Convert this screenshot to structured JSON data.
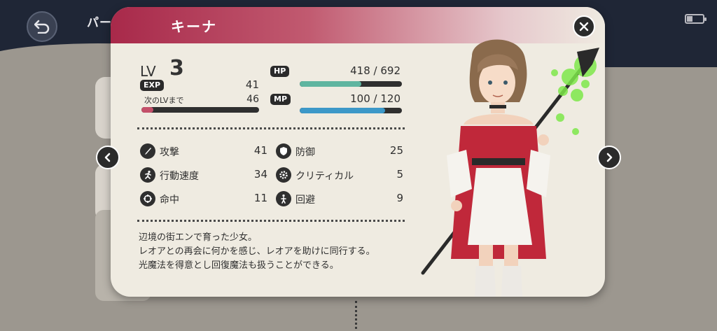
{
  "background": {
    "title": "パーテ",
    "back_icon": "back-arrow-icon",
    "battery_icon": "battery-icon"
  },
  "modal": {
    "title": "キーナ",
    "header_gradient": [
      "#a8294a",
      "#efebe1"
    ],
    "close_icon": "close-icon",
    "prev_icon": "chevron-left-icon",
    "next_icon": "chevron-right-icon"
  },
  "level": {
    "label": "LV",
    "value": "3",
    "exp_label": "EXP",
    "exp_value": "41",
    "next_label": "次のLVまで",
    "next_value": "46",
    "exp_progress": 0.1,
    "exp_color": "#c4506a"
  },
  "hp": {
    "label": "HP",
    "text": "418 / 692",
    "current": 418,
    "max": 692,
    "color": "#5fb5a0"
  },
  "mp": {
    "label": "MP",
    "text": "100 / 120",
    "current": 100,
    "max": 120,
    "color": "#3c98c8"
  },
  "stats": [
    {
      "icon": "sword-icon",
      "label": "攻撃",
      "value": "41"
    },
    {
      "icon": "shield-icon",
      "label": "防御",
      "value": "25"
    },
    {
      "icon": "running-icon",
      "label": "行動速度",
      "value": "34"
    },
    {
      "icon": "gear-icon",
      "label": "クリティカル",
      "value": "5"
    },
    {
      "icon": "crosshair-icon",
      "label": "命中",
      "value": "11"
    },
    {
      "icon": "dodge-icon",
      "label": "回避",
      "value": "9"
    }
  ],
  "description": [
    "辺境の街エンで育った少女。",
    "レオアとの再会に何かを感じ、レオアを助けに同行する。",
    "光魔法を得意とし回復魔法も扱うことができる。"
  ],
  "portrait": {
    "icon": "character-portrait",
    "dress_color": "#c0283a",
    "staff_glow": "#7ee84a"
  }
}
